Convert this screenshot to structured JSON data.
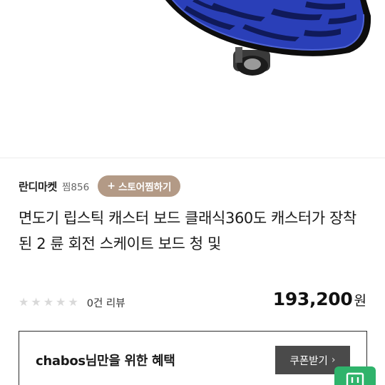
{
  "store": {
    "name": "란디마켓",
    "fav_count": "찜856",
    "fav_button_plus": "+",
    "fav_button_label": "스토어찜하기"
  },
  "product": {
    "title": "면도기 립스틱 캐스터 보드 클래식360도 캐스터가 장착 된 2 륜 회전 스케이트 보드 청 및"
  },
  "rating": {
    "stars_filled": 0,
    "stars_total": 5,
    "review_count": "0건 리뷰"
  },
  "price": {
    "value": "193,200",
    "unit": "원"
  },
  "benefit": {
    "text": "chabos님만을 위한 혜택",
    "coupon_button": "쿠폰받기",
    "coupon_chevron": "›"
  },
  "colors": {
    "store_fav_button": "#b39a86",
    "coupon_button": "#4a4a4a",
    "floating_button": "#2fb36b",
    "board_blue": "#2a3fb8"
  }
}
